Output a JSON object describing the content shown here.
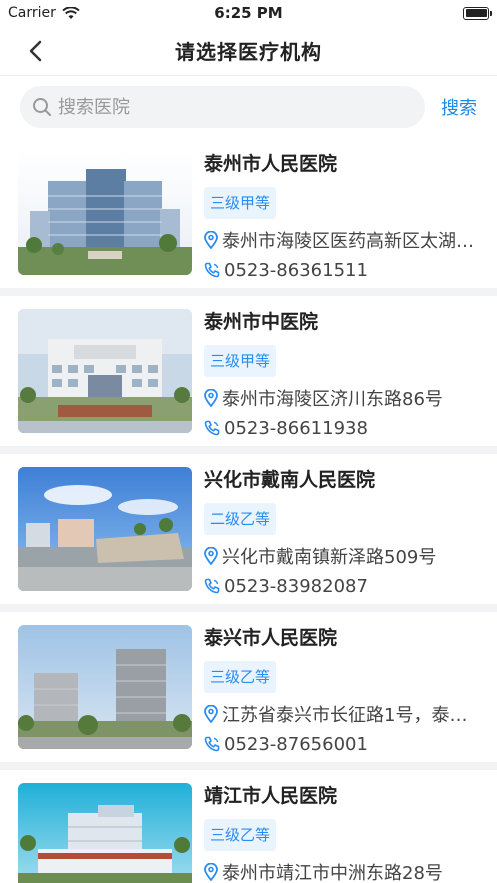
{
  "status_bar": {
    "carrier": "Carrier",
    "time": "6:25 PM"
  },
  "nav": {
    "title": "请选择医疗机构"
  },
  "search": {
    "placeholder": "搜索医院",
    "button_label": "搜索"
  },
  "colors": {
    "accent": "#1e88e5",
    "badge_bg": "#eaf4ff",
    "badge_text": "#2a8cf0"
  },
  "hospitals": [
    {
      "name": "泰州市人民医院",
      "level": "三级甲等",
      "address": "泰州市海陵区医药高新区太湖…",
      "phone": "0523-86361511"
    },
    {
      "name": "泰州市中医院",
      "level": "三级甲等",
      "address": "泰州市海陵区济川东路86号",
      "phone": "0523-86611938"
    },
    {
      "name": "兴化市戴南人民医院",
      "level": "二级乙等",
      "address": "兴化市戴南镇新泽路509号",
      "phone": "0523-83982087"
    },
    {
      "name": "泰兴市人民医院",
      "level": "三级乙等",
      "address": "江苏省泰兴市长征路1号，泰…",
      "phone": "0523-87656001"
    },
    {
      "name": "靖江市人民医院",
      "level": "三级乙等",
      "address": "泰州市靖江市中洲东路28号",
      "phone": ""
    }
  ]
}
